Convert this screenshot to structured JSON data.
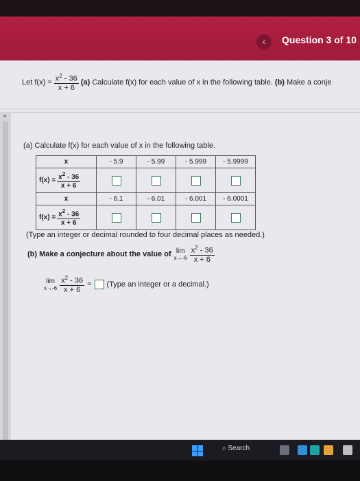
{
  "header": {
    "back_symbol": "‹",
    "question_title": "Question 3 of 10"
  },
  "problem": {
    "let_prefix": "Let f(x) =",
    "num": "x",
    "num_exp": "2",
    "num_rest": " - 36",
    "den": "x + 6",
    "a_label": "(a)",
    "a_text": "Calculate f(x) for each value of x in the following table.",
    "b_label": "(b)",
    "b_text": "Make a conje"
  },
  "part_a": {
    "heading": "(a) Calculate f(x) for each value of x in the following table.",
    "row1": {
      "x_label": "x",
      "values": [
        "- 5.9",
        "- 5.99",
        "- 5.999",
        "- 5.9999"
      ]
    },
    "row2": {
      "x_label": "x",
      "values": [
        "- 6.1",
        "- 6.01",
        "- 6.001",
        "- 6.0001"
      ]
    },
    "fx_label": "f(x) =",
    "fx_num_rest": " - 36",
    "fx_den": "x + 6",
    "note": "(Type an integer or decimal rounded to four decimal places as needed.)"
  },
  "part_b": {
    "text": "(b) Make a conjecture about the value of",
    "lim": "lim",
    "lim_sub": "x→-6",
    "num_rest": " - 36",
    "den": "x + 6",
    "answer_note": "(Type an integer or a decimal.)",
    "equals": "="
  },
  "taskbar": {
    "search_label": "Search"
  }
}
